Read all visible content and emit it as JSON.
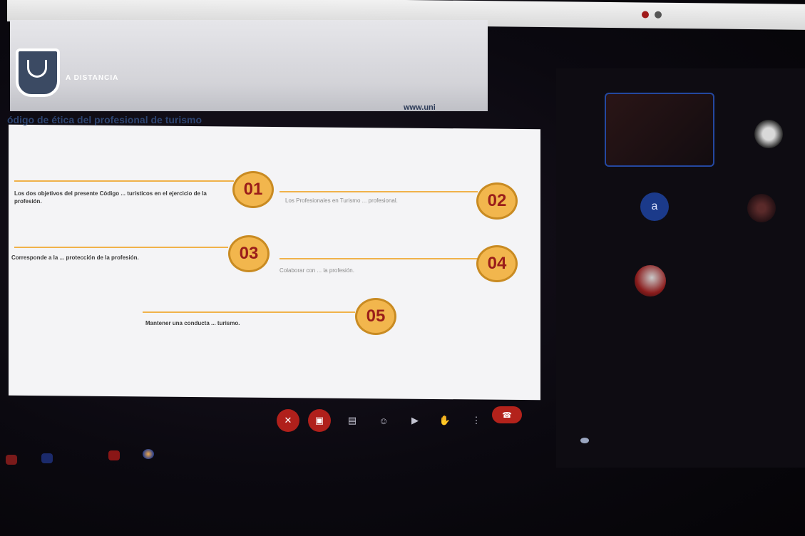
{
  "slide": {
    "logo_text": "A DISTANCIA",
    "url": "www.uni",
    "title": "ódigo de ética del profesional de turismo",
    "items": [
      {
        "number": "01",
        "text": "Los dos objetivos del presente Código ... turísticos en el ejercicio de la profesión."
      },
      {
        "number": "02",
        "text": "Los Profesionales en Turismo ... profesional."
      },
      {
        "number": "03",
        "text": "Corresponde a la ... protección de la profesión."
      },
      {
        "number": "04",
        "text": "Colaborar con ... la profesión."
      },
      {
        "number": "05",
        "text": "Mantener una conducta ... turismo."
      }
    ]
  },
  "participants": [
    {
      "label": "a",
      "caption": ""
    },
    {
      "label": "",
      "caption": ""
    }
  ],
  "controls": {
    "mic_icon": "mic-off-icon",
    "camera_icon": "camera-off-icon",
    "captions_icon": "captions-icon",
    "emoji_icon": "emoji-icon",
    "present_icon": "present-screen-icon",
    "hand_icon": "raise-hand-icon",
    "more_icon": "more-options-icon",
    "end_icon": "end-call-icon"
  },
  "colors": {
    "accent_orange": "#f2b64d",
    "number_text": "#9a1d1a",
    "control_red": "#b0201b",
    "tile_border": "#2448a0"
  }
}
